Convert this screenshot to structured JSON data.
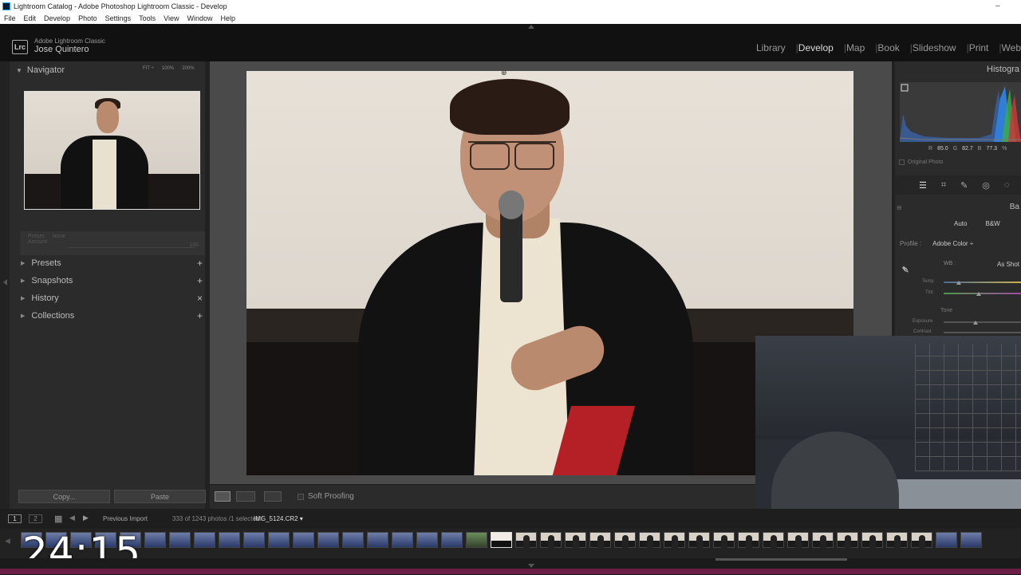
{
  "window": {
    "title": "Lightroom Catalog - Adobe Photoshop Lightroom Classic - Develop"
  },
  "menu": [
    "File",
    "Edit",
    "Develop",
    "Photo",
    "Settings",
    "Tools",
    "View",
    "Window",
    "Help"
  ],
  "identity": {
    "app_name": "Adobe Lightroom Classic",
    "user": "Jose Quintero",
    "logo": "Lrc"
  },
  "modules": {
    "items": [
      "Library",
      "Develop",
      "Map",
      "Book",
      "Slideshow",
      "Print",
      "Web"
    ],
    "active": "Develop"
  },
  "navigator": {
    "title": "Navigator",
    "zoom": [
      "FIT ÷",
      "100%",
      "200%"
    ]
  },
  "preset_box": {
    "preset_label": "Preset",
    "preset_value": "None",
    "amount_label": "Amount",
    "amount_value": "100"
  },
  "left_panels": [
    {
      "label": "Presets",
      "control": "+"
    },
    {
      "label": "Snapshots",
      "control": "+"
    },
    {
      "label": "History",
      "control": "×"
    },
    {
      "label": "Collections",
      "control": "+"
    }
  ],
  "buttons": {
    "copy": "Copy...",
    "paste": "Paste"
  },
  "toolbar": {
    "soft_proofing": "Soft Proofing"
  },
  "right": {
    "histogram_title": "Histogra",
    "rgb": {
      "r_label": "R",
      "r": "85.0",
      "g_label": "G",
      "g": "82.7",
      "b_label": "B",
      "b": "77.3",
      "pct": "%"
    },
    "original_photo": "Original Photo",
    "basic_title": "Ba",
    "auto": "Auto",
    "bw": "B&W",
    "profile_label": "Profile :",
    "profile_value": "Adobe Color ÷",
    "wb_label": "WB :",
    "wb_value": "As Shot",
    "temp_label": "Temp",
    "tint_label": "Tint",
    "tone_label": "Tone",
    "exposure_label": "Exposure",
    "contrast_label": "Contrast"
  },
  "filmstrip": {
    "view1": "1",
    "view2": "2",
    "source": "Previous Import",
    "count": "333 of 1243 photos /1 selected /",
    "file": "IMG_5124.CR2 ▾"
  },
  "overlay": {
    "timer": "24:15"
  },
  "colors": {
    "accent_histogram_blue": "#2f7fd8",
    "pink_bar": "#6b1f46"
  }
}
